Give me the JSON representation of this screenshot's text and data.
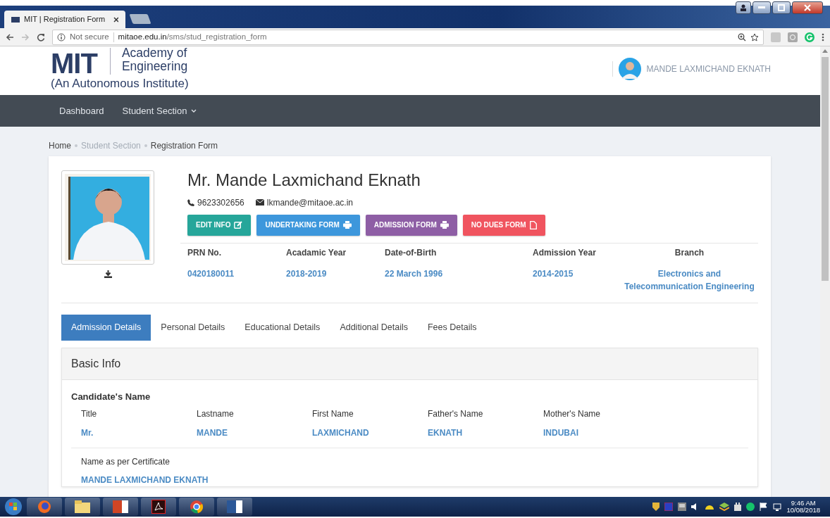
{
  "browser": {
    "tab_title": "MIT | Registration Form",
    "security": "Not secure",
    "url_host": "mitaoe.edu.in",
    "url_path": "/sms/stud_registration_form"
  },
  "header": {
    "logo_mark": "MIT",
    "logo_lines": [
      "Academy of",
      "Engineering"
    ],
    "tagline": "(An Autonomous Institute)",
    "user_name": "MANDE LAXMICHAND EKNATH"
  },
  "nav": [
    {
      "label": "Dashboard",
      "has_menu": false
    },
    {
      "label": "Student Section",
      "has_menu": true
    }
  ],
  "breadcrumb": [
    {
      "label": "Home",
      "muted": false
    },
    {
      "label": "Student Section",
      "muted": true
    },
    {
      "label": "Registration Form",
      "muted": false
    }
  ],
  "profile": {
    "name": "Mr. Mande Laxmichand Eknath",
    "phone": "9623302656",
    "email": "lkmande@mitaoe.ac.in",
    "buttons": [
      {
        "label": "EDIT INFO",
        "color": "#26a69a",
        "kind": "edit"
      },
      {
        "label": "UNDERTAKING FORM",
        "color": "#3d97dc",
        "kind": "print"
      },
      {
        "label": "ADMISSION FORM",
        "color": "#8e5ea5",
        "kind": "print"
      },
      {
        "label": "NO DUES FORM",
        "color": "#f0545f",
        "kind": "file"
      }
    ],
    "fields": [
      {
        "label": "PRN No.",
        "value": "0420180011"
      },
      {
        "label": "Acadamic Year",
        "value": "2018-2019"
      },
      {
        "label": "Date-of-Birth",
        "value": "22 March 1996"
      },
      {
        "label": "Admission Year",
        "value": "2014-2015"
      },
      {
        "label": "Branch",
        "value": "Electronics and Telecommunication Engineering"
      }
    ]
  },
  "tabs": [
    {
      "label": "Admission Details",
      "selected": true
    },
    {
      "label": "Personal Details",
      "selected": false
    },
    {
      "label": "Educational Details",
      "selected": false
    },
    {
      "label": "Additional Details",
      "selected": false
    },
    {
      "label": "Fees Details",
      "selected": false
    }
  ],
  "panel": {
    "title": "Basic Info",
    "section": "Candidate's Name",
    "fields": [
      {
        "label": "Title",
        "value": "Mr."
      },
      {
        "label": "Lastname",
        "value": "MANDE"
      },
      {
        "label": "First Name",
        "value": "LAXMICHAND"
      },
      {
        "label": "Father's Name",
        "value": "EKNATH"
      },
      {
        "label": "Mother's Name",
        "value": "INDUBAI"
      }
    ],
    "certificate": {
      "label": "Name as per Certificate",
      "value": "MANDE LAXMICHAND EKNATH"
    }
  },
  "taskbar": {
    "time": "9:46 AM",
    "date": "10/08/2018"
  }
}
